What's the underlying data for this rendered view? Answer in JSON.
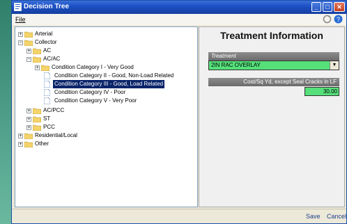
{
  "window": {
    "title": "Decision Tree"
  },
  "menu": {
    "file_label": "File"
  },
  "tree": {
    "items": [
      {
        "label": "Arterial"
      },
      {
        "label": "Collector"
      },
      {
        "label": "AC"
      },
      {
        "label": "AC/AC"
      },
      {
        "label": "Condition Category I - Very Good"
      },
      {
        "label": "Condition Category II - Good, Non-Load Related"
      },
      {
        "label": "Condition Category III - Good, Load Related"
      },
      {
        "label": "Condition Category IV - Poor"
      },
      {
        "label": "Condition Category V - Very Poor"
      },
      {
        "label": "AC/PCC"
      },
      {
        "label": "ST"
      },
      {
        "label": "PCC"
      },
      {
        "label": "Residential/Local"
      },
      {
        "label": "Other"
      }
    ],
    "selected_label": "Condition Category III - Good, Load Related"
  },
  "info": {
    "heading": "Treatment Information",
    "treatment_label": "Treatment",
    "treatment_value": "2IN RAC OVERLAY",
    "cost_label": "Cost/Sq Yd, except Seal Cracks in LF",
    "cost_value": "30.00"
  },
  "footer": {
    "save_label": "Save",
    "cancel_label": "Cancel"
  },
  "colors": {
    "title_bar": "#1a4fc3",
    "field_fill": "#55e07a",
    "selection": "#0a246a",
    "desktop": "#3f8f78"
  },
  "icons": {
    "window": "app-icon",
    "folder": "folder-icon",
    "document": "document-icon",
    "refresh": "refresh-icon",
    "help": "help-icon"
  }
}
